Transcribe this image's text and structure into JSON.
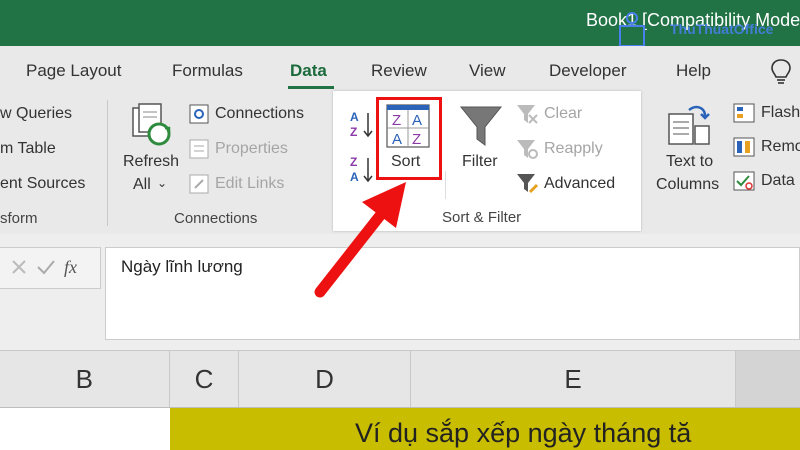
{
  "title": "Book1 [Compatibility Mode",
  "watermark": "ThuThuatOffice",
  "tabs": [
    "Page Layout",
    "Formulas",
    "Data",
    "Review",
    "View",
    "Developer",
    "Help"
  ],
  "active_tab": "Data",
  "ribbon": {
    "get_transform": {
      "items": [
        "w Queries",
        "m Table",
        "ent Sources"
      ],
      "group_label": "sform"
    },
    "connections": {
      "refresh_line1": "Refresh",
      "refresh_line2": "All",
      "items": [
        "Connections",
        "Properties",
        "Edit Links"
      ],
      "group_label": "Connections"
    },
    "sort_filter": {
      "sort_label": "Sort",
      "filter_label": "Filter",
      "clear_label": "Clear",
      "reapply_label": "Reapply",
      "advanced_label": "Advanced",
      "group_label": "Sort & Filter"
    },
    "data_tools": {
      "text_to_columns_line1": "Text to",
      "text_to_columns_line2": "Columns",
      "items": [
        "Flash",
        "Remo",
        "Data"
      ]
    }
  },
  "formula_bar": {
    "fx": "fx",
    "content": "Ngày lĩnh lương"
  },
  "columns": [
    "B",
    "C",
    "D",
    "E"
  ],
  "cell_text": "Ví dụ sắp xếp ngày tháng tă",
  "colors": {
    "accent": "#217346",
    "highlight": "#e11111",
    "cell_fill": "#c9bd00"
  }
}
